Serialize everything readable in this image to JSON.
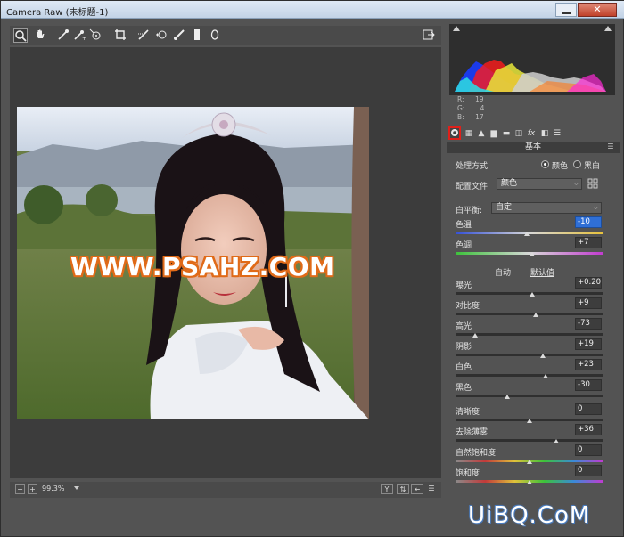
{
  "window": {
    "title": "Camera Raw (未标题-1)",
    "close_label": "✕"
  },
  "toolbar": {
    "tools": [
      {
        "name": "zoom-tool",
        "glyph": "🔍"
      },
      {
        "name": "hand-tool",
        "glyph": "✋"
      },
      {
        "name": "white-balance-tool",
        "glyph": "✎"
      },
      {
        "name": "color-sampler-tool",
        "glyph": "✎"
      },
      {
        "name": "targeted-adjustment-tool",
        "glyph": "⊙"
      },
      {
        "name": "crop-tool",
        "glyph": "⌗"
      },
      {
        "name": "straighten-tool",
        "glyph": "⟋"
      },
      {
        "name": "spot-removal-tool",
        "glyph": "✛"
      },
      {
        "name": "adjustment-brush-tool",
        "glyph": "✏"
      },
      {
        "name": "graduated-filter-tool",
        "glyph": "▮"
      },
      {
        "name": "radial-filter-tool",
        "glyph": "○"
      }
    ],
    "open_prefs_glyph": "⇱"
  },
  "canvas": {
    "watermark": "WWW.PSAHZ.COM"
  },
  "statusbar": {
    "zoom": "99.3%",
    "zoom_out": "−",
    "zoom_in": "+"
  },
  "histogram": {
    "r_label": "R:",
    "r_value": "19",
    "g_label": "G:",
    "g_value": "4",
    "b_label": "B:",
    "b_value": "17"
  },
  "panel": {
    "title": "基本",
    "treatment_label": "处理方式:",
    "treatment_color": "颜色",
    "treatment_bw": "黑白",
    "profile_label": "配置文件:",
    "profile_value": "颜色",
    "wb_label": "白平衡:",
    "wb_value": "自定",
    "auto": "自动",
    "default": "默认值",
    "sliders": [
      {
        "key": "temp",
        "label": "色温",
        "value": "-10",
        "pos": 0.48,
        "highlight": true
      },
      {
        "key": "tint",
        "label": "色调",
        "value": "+7",
        "pos": 0.52
      },
      {
        "key": "exposure",
        "label": "曝光",
        "value": "+0.20",
        "pos": 0.52
      },
      {
        "key": "contrast",
        "label": "对比度",
        "value": "+9",
        "pos": 0.54
      },
      {
        "key": "highlights",
        "label": "高光",
        "value": "-73",
        "pos": 0.13
      },
      {
        "key": "shadows",
        "label": "阴影",
        "value": "+19",
        "pos": 0.59
      },
      {
        "key": "whites",
        "label": "白色",
        "value": "+23",
        "pos": 0.61
      },
      {
        "key": "blacks",
        "label": "黑色",
        "value": "-30",
        "pos": 0.35
      },
      {
        "key": "clarity",
        "label": "清晰度",
        "value": "0",
        "pos": 0.5
      },
      {
        "key": "dehaze",
        "label": "去除薄雾",
        "value": "+36",
        "pos": 0.68
      },
      {
        "key": "vibrance",
        "label": "自然饱和度",
        "value": "0",
        "pos": 0.5
      },
      {
        "key": "saturation",
        "label": "饱和度",
        "value": "0",
        "pos": 0.5
      }
    ]
  },
  "site_logo": "UiBQ.CoM"
}
